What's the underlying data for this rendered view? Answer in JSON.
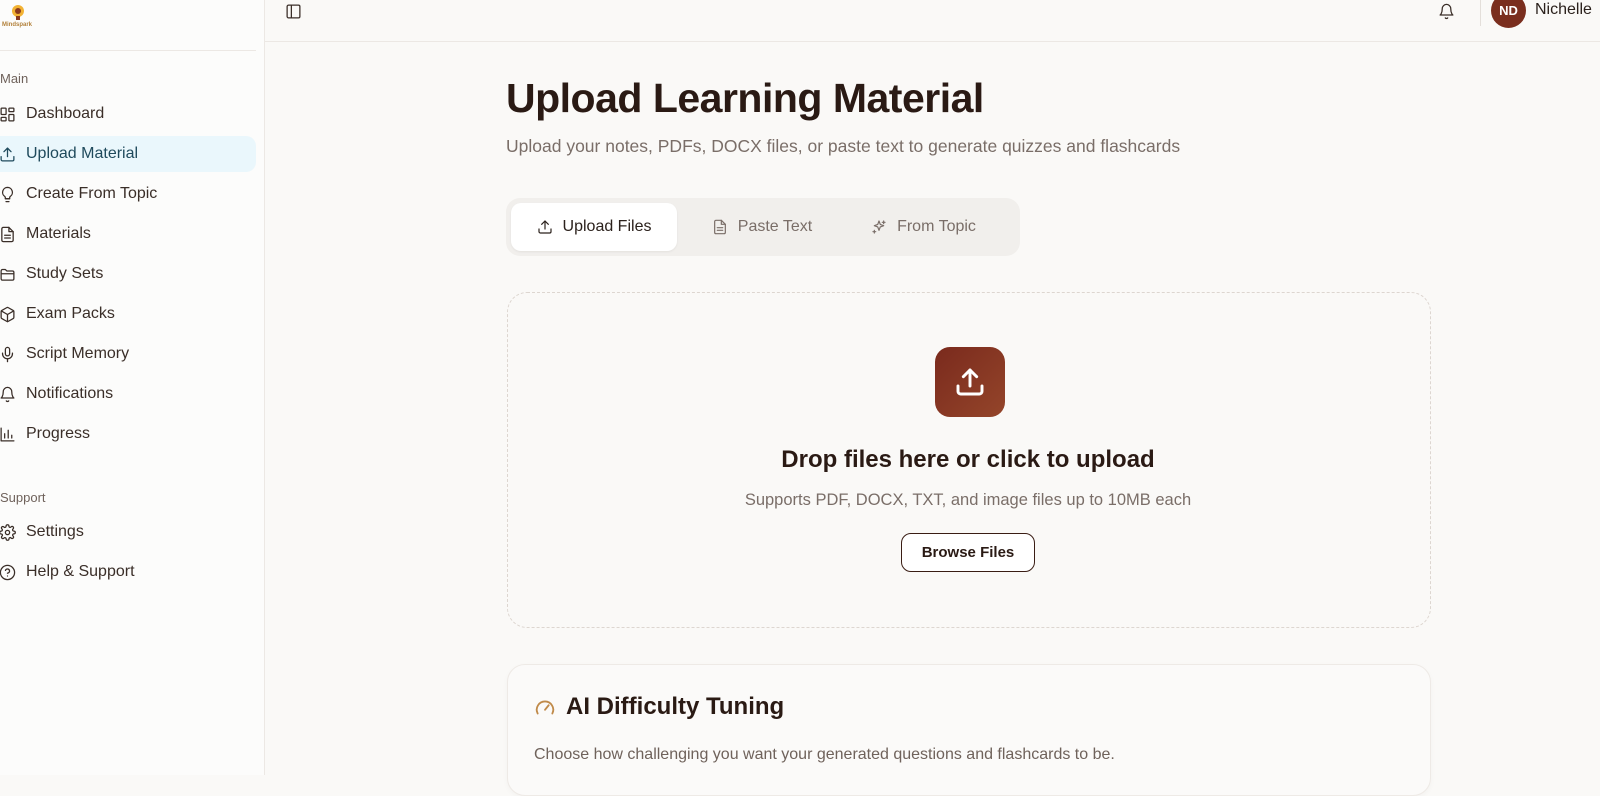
{
  "brand": {
    "logo_text": "Mindspark"
  },
  "sidebar": {
    "main_label": "Main",
    "support_label": "Support",
    "items": [
      {
        "label": "Dashboard",
        "icon": "dashboard-icon"
      },
      {
        "label": "Upload Material",
        "icon": "upload-icon",
        "active": true
      },
      {
        "label": "Create From Topic",
        "icon": "lightbulb-icon"
      },
      {
        "label": "Materials",
        "icon": "document-icon"
      },
      {
        "label": "Study Sets",
        "icon": "folder-icon"
      },
      {
        "label": "Exam Packs",
        "icon": "package-icon"
      },
      {
        "label": "Script Memory",
        "icon": "microphone-icon"
      },
      {
        "label": "Notifications",
        "icon": "bell-icon"
      },
      {
        "label": "Progress",
        "icon": "bar-chart-icon"
      }
    ],
    "support_items": [
      {
        "label": "Settings",
        "icon": "gear-icon"
      },
      {
        "label": "Help & Support",
        "icon": "help-circle-icon"
      }
    ]
  },
  "topbar": {
    "user_initials": "ND",
    "user_name": "Nichelle"
  },
  "main": {
    "title": "Upload Learning Material",
    "subtitle": "Upload your notes, PDFs, DOCX files, or paste text to generate quizzes and flashcards",
    "tabs": [
      {
        "label": "Upload Files",
        "icon": "upload-icon",
        "active": true
      },
      {
        "label": "Paste Text",
        "icon": "document-icon"
      },
      {
        "label": "From Topic",
        "icon": "sparkles-icon"
      }
    ],
    "dropzone": {
      "title": "Drop files here or click to upload",
      "subtitle": "Supports PDF, DOCX, TXT, and image files up to 10MB each",
      "button_label": "Browse Files"
    },
    "difficulty_card": {
      "title": "AI Difficulty Tuning",
      "description": "Choose how challenging you want your generated questions and flashcards to be."
    }
  },
  "colors": {
    "accent": "#7a2a1d",
    "active_nav_bg": "#eaf7fc",
    "background": "#faf9f7"
  }
}
